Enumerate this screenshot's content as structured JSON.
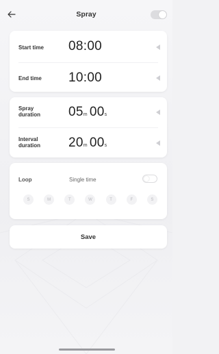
{
  "header": {
    "back_icon": "arrow-left-icon",
    "title": "Spray",
    "toggle_on": false
  },
  "schedule": {
    "start_label": "Start time",
    "start_value": "08:00",
    "end_label": "End time",
    "end_value": "10:00"
  },
  "durations": {
    "spray_label_1": "Spray",
    "spray_label_2": "duration",
    "spray_minutes": "05",
    "spray_seconds": "00",
    "interval_label_1": "Interval",
    "interval_label_2": "duration",
    "interval_minutes": "20",
    "interval_seconds": "00",
    "minute_unit": "m",
    "second_unit": "s"
  },
  "loop": {
    "loop_label": "Loop",
    "single_time_label": "Single time",
    "toggle_on": false,
    "days": [
      "S",
      "M",
      "T",
      "W",
      "T",
      "F",
      "S"
    ]
  },
  "save_label": "Save",
  "colors": {
    "background": "#f2f2f4",
    "card": "#ffffff",
    "muted": "#b8b8bd"
  }
}
